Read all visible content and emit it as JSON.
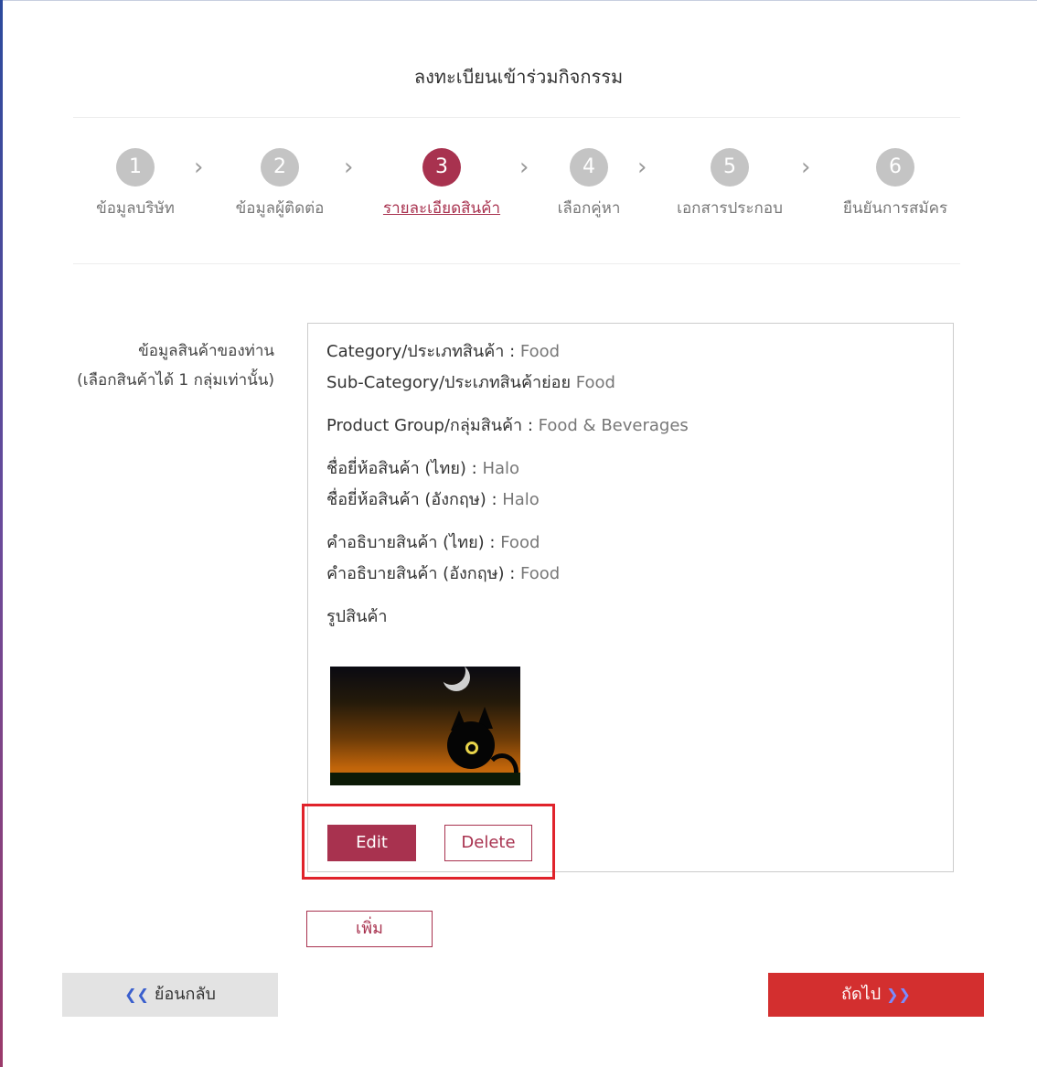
{
  "page": {
    "title": "ลงทะเบียนเข้าร่วมกิจกรรม"
  },
  "steps": [
    {
      "number": "1",
      "label": "ข้อมูลบริษัท",
      "active": false
    },
    {
      "number": "2",
      "label": "ข้อมูลผู้ติดต่อ",
      "active": false
    },
    {
      "number": "3",
      "label": "รายละเอียดสินค้า",
      "active": true
    },
    {
      "number": "4",
      "label": "เลือกคู่หา",
      "active": false
    },
    {
      "number": "5",
      "label": "เอกสารประกอบ",
      "active": false
    },
    {
      "number": "6",
      "label": "ยืนยันการสมัคร",
      "active": false
    }
  ],
  "product_section": {
    "label_line1": "ข้อมูลสินค้าของท่าน",
    "label_line2": "(เลือกสินค้าได้ 1 กลุ่มเท่านั้น)"
  },
  "product": {
    "category_label": "Category/ประเภทสินค้า : ",
    "category_value": "Food",
    "subcategory_label": "Sub-Category/ประเภทสินค้าย่อย ",
    "subcategory_value": "Food",
    "group_label": "Product Group/กลุ่มสินค้า : ",
    "group_value": "Food & Beverages",
    "brand_th_label": "ชื่อยี่ห้อสินค้า (ไทย) : ",
    "brand_th_value": "Halo",
    "brand_en_label": "ชื่อยี่ห้อสินค้า (อังกฤษ) : ",
    "brand_en_value": "Halo",
    "desc_th_label": "คำอธิบายสินค้า (ไทย) : ",
    "desc_th_value": "Food",
    "desc_en_label": "คำอธิบายสินค้า (อังกฤษ) : ",
    "desc_en_value": "Food",
    "image_label": "รูปสินค้า"
  },
  "buttons": {
    "edit": "Edit",
    "delete": "Delete",
    "add": "เพิ่ม",
    "back": "ย้อนกลับ",
    "next": "ถัดไป"
  },
  "icons": {
    "back": "double-chevron-left-icon",
    "next": "double-chevron-right-icon",
    "step_separator": "chevron-right-icon"
  },
  "colors": {
    "accent": "#a8324f",
    "next_button": "#d32f2f",
    "step_inactive": "#c4c4c4",
    "highlight_border": "#e0232b"
  }
}
